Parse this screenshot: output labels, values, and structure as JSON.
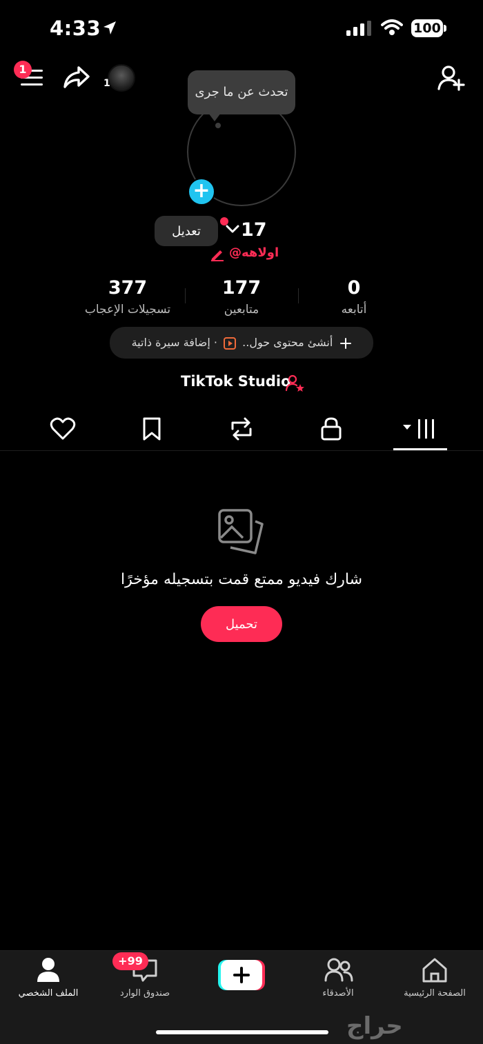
{
  "status_bar": {
    "time": "4:33",
    "battery": "100"
  },
  "header": {
    "menu_badge": "1",
    "mini_avatar_count": "1",
    "tooltip": "تحدث عن ما جرى"
  },
  "profile": {
    "edit_label": "تعديل",
    "username_number": "17",
    "handle": "@اولاهه"
  },
  "stats": [
    {
      "value": "377",
      "label": "تسجيلات الإعجاب"
    },
    {
      "value": "177",
      "label": "متابعين"
    },
    {
      "value": "0",
      "label": "أتابعه"
    }
  ],
  "bio_pill": {
    "add_bio": "إضافة سيرة ذاتية",
    "separator": "·",
    "create_content": "أنشئ محتوى حول.."
  },
  "studio": {
    "label": "TikTok Studio"
  },
  "tabs": [
    "liked-icon",
    "favorites-icon",
    "reposts-icon",
    "private-icon",
    "videos-icon"
  ],
  "empty_state": {
    "message": "شارك فيديو ممتع قمت بتسجيله مؤخرًا",
    "button": "تحميل"
  },
  "bottom_nav": {
    "profile": "الملف الشخصي",
    "inbox": "صندوق الوارد",
    "inbox_badge": "+99",
    "friends": "الأصدقاء",
    "home": "الصفحة الرئيسية"
  },
  "watermark": "حراج",
  "colors": {
    "accent": "#fe2c55",
    "blue": "#20c4f0",
    "background": "#000000"
  }
}
